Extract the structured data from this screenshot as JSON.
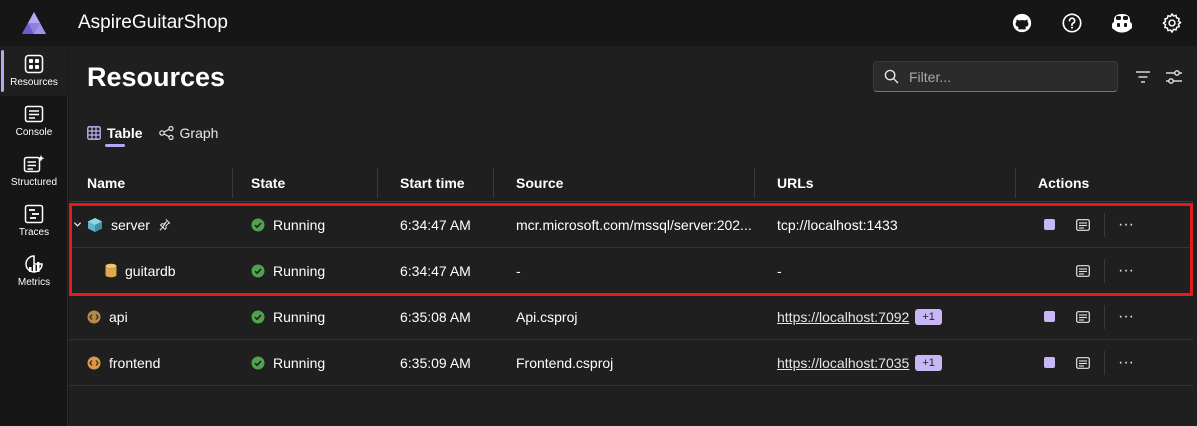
{
  "app": {
    "title": "AspireGuitarShop"
  },
  "sidebar": {
    "items": [
      {
        "label": "Resources",
        "icon": "resources-icon",
        "active": true
      },
      {
        "label": "Console",
        "icon": "console-icon"
      },
      {
        "label": "Structured",
        "icon": "structured-icon"
      },
      {
        "label": "Traces",
        "icon": "traces-icon"
      },
      {
        "label": "Metrics",
        "icon": "metrics-icon"
      }
    ]
  },
  "header": {
    "page_title": "Resources",
    "filter_placeholder": "Filter..."
  },
  "tabs": [
    {
      "label": "Table",
      "icon": "table-icon",
      "active": true
    },
    {
      "label": "Graph",
      "icon": "graph-icon"
    }
  ],
  "table": {
    "columns": [
      "Name",
      "State",
      "Start time",
      "Source",
      "URLs",
      "Actions"
    ],
    "rows": [
      {
        "name": "server",
        "icon": "container-icon",
        "state": "Running",
        "start": "6:34:47 AM",
        "source": "mcr.microsoft.com/mssql/server:202...",
        "url": "tcp://localhost:1433",
        "url_link": false,
        "extra": "",
        "stop": true
      },
      {
        "name": "guitardb",
        "icon": "database-icon",
        "state": "Running",
        "start": "6:34:47 AM",
        "source": "-",
        "url": "-",
        "url_link": false,
        "extra": "",
        "stop": false
      },
      {
        "name": "api",
        "icon": "project-icon",
        "state": "Running",
        "start": "6:35:08 AM",
        "source": "Api.csproj",
        "url": "https://localhost:7092",
        "url_link": true,
        "extra": "+1",
        "stop": true
      },
      {
        "name": "frontend",
        "icon": "project-icon",
        "state": "Running",
        "start": "6:35:09 AM",
        "source": "Frontend.csproj",
        "url": "https://localhost:7035",
        "url_link": true,
        "extra": "+1",
        "stop": true
      }
    ]
  },
  "colors": {
    "accent": "#b7a6f2",
    "running": "#4fa34f",
    "highlight": "#e21b1b"
  }
}
